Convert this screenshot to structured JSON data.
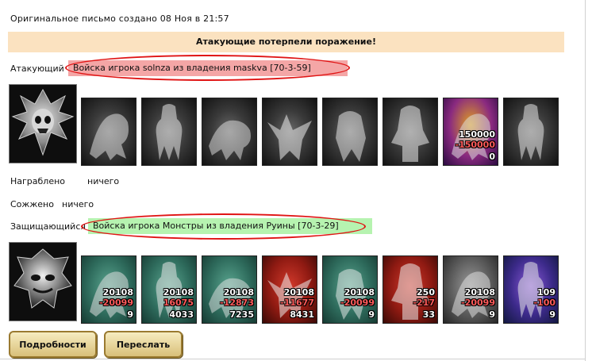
{
  "created_text": "Оригинальное письмо создано 08 Ноя в 21:57",
  "banner": "Атакующие потерпели поражение!",
  "attacker": {
    "label": "Атакующий",
    "army": "Войска игрока solnza из владения maskva [70-3-59]",
    "units": [
      {
        "icon": "dragon-unit-icon",
        "theme": "gray"
      },
      {
        "icon": "skeleton-knight-unit-icon",
        "theme": "gray"
      },
      {
        "icon": "hound-unit-icon",
        "theme": "gray"
      },
      {
        "icon": "gargoyle-unit-icon",
        "theme": "gray"
      },
      {
        "icon": "beast-unit-icon",
        "theme": "gray"
      },
      {
        "icon": "hooded-warrior-unit-icon",
        "theme": "gray"
      },
      {
        "icon": "demon-lord-unit-icon",
        "theme": "gold",
        "count": "150000",
        "loss": "-150000",
        "left": "0"
      },
      {
        "icon": "wraith-unit-icon",
        "theme": "gray"
      }
    ]
  },
  "looted": {
    "label": "Награблено",
    "value": "ничего"
  },
  "burned": {
    "label": "Сожжено",
    "value": "ничего"
  },
  "defender": {
    "label": "Защищающийся",
    "army": "Войска игрока Монстры из владения Руины [70-3-29]",
    "units": [
      {
        "icon": "lizard-unit-icon",
        "theme": "teal",
        "count": "20108",
        "loss": "-20099",
        "left": "9"
      },
      {
        "icon": "golem-unit-icon",
        "theme": "teal",
        "count": "20108",
        "loss": "16075",
        "left": "4033"
      },
      {
        "icon": "orc-unit-icon",
        "theme": "teal",
        "count": "20108",
        "loss": "-12873",
        "left": "7235"
      },
      {
        "icon": "red-demon-unit-icon",
        "theme": "red",
        "count": "20108",
        "loss": "-11677",
        "left": "8431"
      },
      {
        "icon": "spider-unit-icon",
        "theme": "teal",
        "count": "20108",
        "loss": "-20099",
        "left": "9"
      },
      {
        "icon": "red-fiend-unit-icon",
        "theme": "red",
        "count": "250",
        "loss": "-217",
        "left": "33"
      },
      {
        "icon": "tombstone-unit-icon",
        "theme": "grayr",
        "count": "20108",
        "loss": "-20099",
        "left": "9"
      },
      {
        "icon": "purple-witch-unit-icon",
        "theme": "violet",
        "count": "109",
        "loss": "-100",
        "left": "9"
      }
    ]
  },
  "buttons": {
    "details": "Подробности",
    "forward": "Переслать"
  },
  "colors": {
    "banner_bg": "#fbe2c0",
    "attacker_bg": "#f4a6a6",
    "defender_bg": "#b6f3b0",
    "highlight": "#e01414"
  }
}
